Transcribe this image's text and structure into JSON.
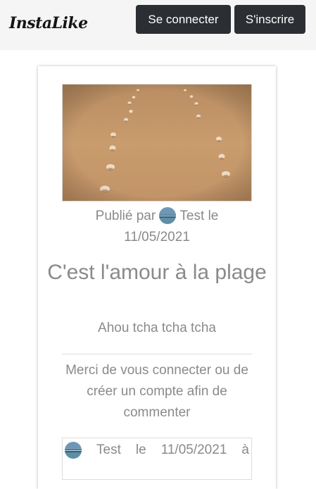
{
  "navbar": {
    "brand": "InstaLike",
    "login_label": "Se connecter",
    "signup_label": "S'inscrire"
  },
  "post": {
    "image_alt": "Footprints in the sand",
    "published_prefix": "Publié par",
    "author": "Test",
    "date_prefix": "le",
    "date": "11/05/2021",
    "title": "C'est l'amour à la plage",
    "description": "Ahou tcha tcha tcha"
  },
  "comments": {
    "login_prompt": "Merci de vous connecter ou de créer un compte afin de commenter",
    "items": [
      {
        "author": "Test",
        "date_prefix": "le",
        "date": "11/05/2021",
        "suffix": "à"
      }
    ]
  },
  "colors": {
    "navbar_bg": "#f5f5f5",
    "button_bg": "#2b2f33",
    "text_muted": "#8a8a8a",
    "sand": "#c99a6b"
  }
}
